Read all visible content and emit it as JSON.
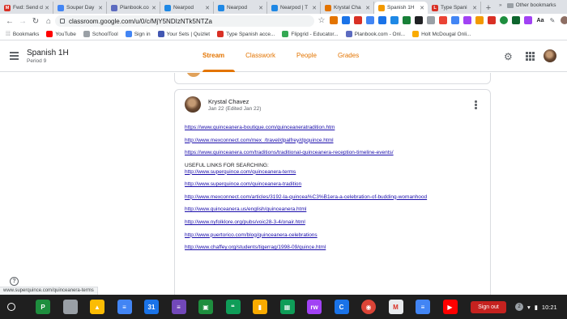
{
  "browser": {
    "tabs": [
      {
        "title": "Fwd: Send cl",
        "color": "#d93025",
        "glyph": "M"
      },
      {
        "title": "Souper Day",
        "color": "#4285f4",
        "glyph": ""
      },
      {
        "title": "Planbook.co",
        "color": "#5c6bc0",
        "glyph": ""
      },
      {
        "title": "Nearpod",
        "color": "#1e88e5",
        "glyph": ""
      },
      {
        "title": "Nearpod",
        "color": "#1e88e5",
        "glyph": ""
      },
      {
        "title": "Nearpod | T",
        "color": "#1e88e5",
        "glyph": ""
      },
      {
        "title": "Krystal Cha",
        "color": "#e37400",
        "glyph": ""
      },
      {
        "title": "Spanish 1H",
        "color": "#f29900",
        "glyph": "",
        "active": true
      },
      {
        "title": "Type Spani",
        "color": "#d93025",
        "glyph": "L"
      }
    ],
    "url": "classroom.google.com/u/0/c/MjY5NDIzNTk5NTZa",
    "bookmarks_label": "Bookmarks",
    "bookmarks": [
      {
        "label": "YouTube",
        "color": "#ff0000"
      },
      {
        "label": "SchoolTool",
        "color": "#9aa0a6"
      },
      {
        "label": "Sign in",
        "color": "#4285f4"
      },
      {
        "label": "Your Sets | Quizlet",
        "color": "#4257b2"
      },
      {
        "label": "Type Spanish acce...",
        "color": "#d93025"
      },
      {
        "label": "Flipgrid - Educator...",
        "color": "#34a853"
      },
      {
        "label": "Planbook.com - Onl...",
        "color": "#5c6bc0"
      },
      {
        "label": "Holt McDougal Onli...",
        "color": "#f9ab00"
      }
    ],
    "other_bookmarks": "Other bookmarks"
  },
  "classroom": {
    "class_name": "Spanish 1H",
    "section": "Period 9",
    "tabs": [
      "Stream",
      "Classwork",
      "People",
      "Grades"
    ]
  },
  "post": {
    "author": "Krystal Chavez",
    "date": "Jan 22 (Edited Jan 22)",
    "lines": [
      {
        "text": "https://www.quinceanera-boutique.com/quinceaneratradition.htm",
        "link": true
      },
      {
        "text": "",
        "link": false
      },
      {
        "text": "http://www.mexconnect.com/mex_/travel/dpalfrey/dpquince.html",
        "link": true
      },
      {
        "text": "",
        "link": false
      },
      {
        "text": "https://www.quinceanera.com/traditions/traditional-quinceanera-reception-timeline-events/",
        "link": true
      },
      {
        "text": "",
        "link": false
      },
      {
        "text": "USEFUL LINKS FOR SEARCHING:",
        "link": false
      },
      {
        "text": "http://www.superquince.com/quinceanera-terms",
        "link": true
      },
      {
        "text": "",
        "link": false
      },
      {
        "text": "http://www.superquince.com/quinceanera-tradition",
        "link": true
      },
      {
        "text": "",
        "link": false
      },
      {
        "text": "http://www.mexconnect.com/articles/3192-la-quincea%C3%B1era-a-celebration-of-budding-womanhood",
        "link": true
      },
      {
        "text": "",
        "link": false
      },
      {
        "text": "http://www.quinceanera.us/english/quinceanera.html",
        "link": true
      },
      {
        "text": "",
        "link": false
      },
      {
        "text": "http://www.nyfolklore.org/pubs/voic28-3-4/onair.html",
        "link": true
      },
      {
        "text": "",
        "link": false
      },
      {
        "text": "http://www.puertorico.com/blog/quinceanera-celebrations",
        "link": true
      },
      {
        "text": "",
        "link": false
      },
      {
        "text": "http://www.chaffey.org/students/tigerrag/1998-09/quince.html",
        "link": true
      }
    ]
  },
  "status_url": "www.superquince.com/quinceanera-terms",
  "shelf": {
    "apps": [
      {
        "name": "classroom",
        "color": "#1e8e3e",
        "glyph": "P"
      },
      {
        "name": "slides-yellow",
        "color": "#9aa0a6",
        "glyph": ""
      },
      {
        "name": "drive",
        "color": "#fbbc04",
        "glyph": "▲"
      },
      {
        "name": "docs",
        "color": "#4285f4",
        "glyph": "≡"
      },
      {
        "name": "calendar",
        "color": "#1a73e8",
        "glyph": "31"
      },
      {
        "name": "forms",
        "color": "#7248b9",
        "glyph": "≡"
      },
      {
        "name": "classroom-2",
        "color": "#1e8e3e",
        "glyph": "▣"
      },
      {
        "name": "hangouts",
        "color": "#0f9d58",
        "glyph": "❝"
      },
      {
        "name": "keep",
        "color": "#f9ab00",
        "glyph": "▮"
      },
      {
        "name": "sheets",
        "color": "#0f9d58",
        "glyph": "▦"
      },
      {
        "name": "read-write",
        "color": "#a142f4",
        "glyph": "rw"
      },
      {
        "name": "citrix",
        "color": "#1a73e8",
        "glyph": "C"
      },
      {
        "name": "chrome",
        "color": "#db4437",
        "glyph": "◉"
      },
      {
        "name": "gmail",
        "color": "#e8eaed",
        "glyph": "M"
      },
      {
        "name": "docs-2",
        "color": "#4285f4",
        "glyph": "≡"
      },
      {
        "name": "youtube",
        "color": "#ff0000",
        "glyph": "▶"
      }
    ],
    "signout": "Sign out",
    "notif_count": "2",
    "time": "10:21"
  }
}
